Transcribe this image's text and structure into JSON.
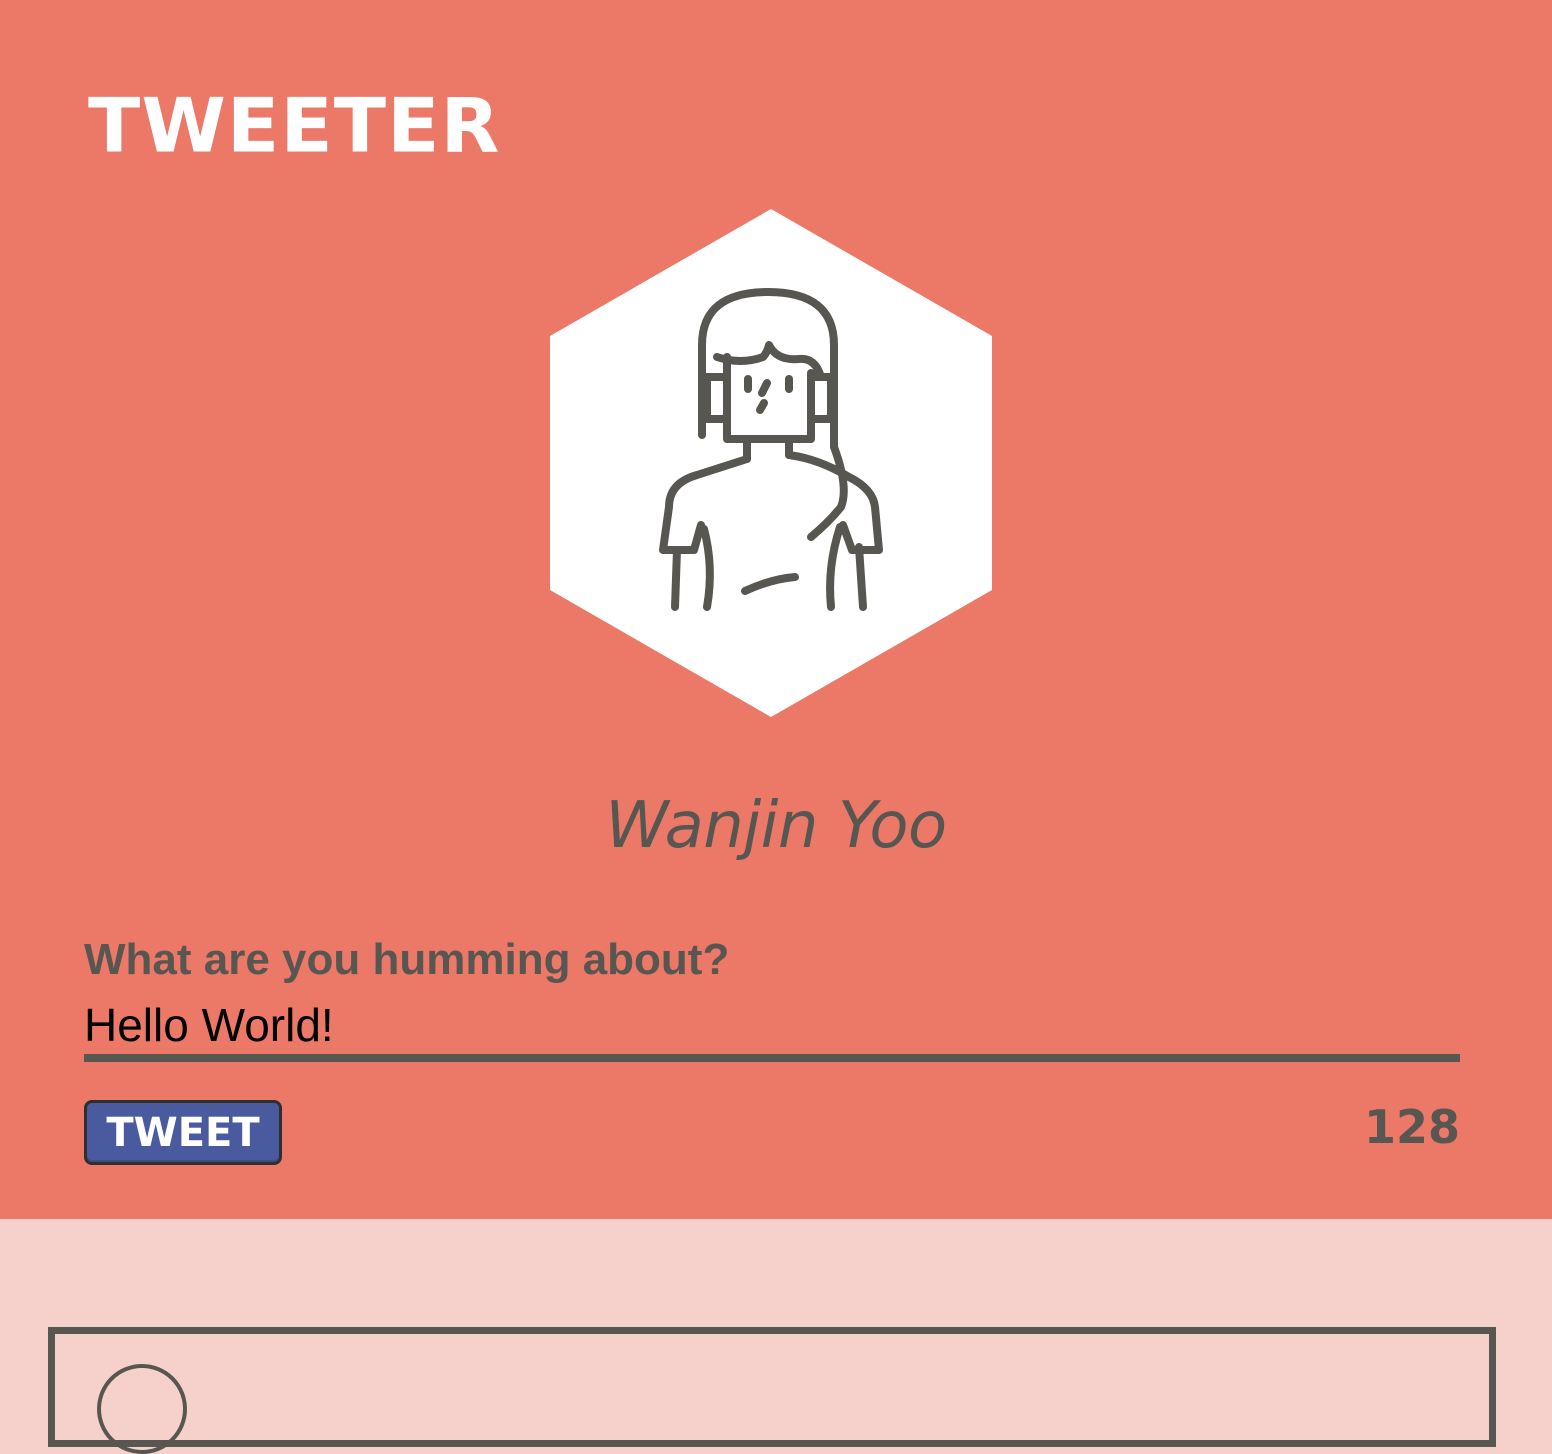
{
  "app": {
    "brand": "TWEETER"
  },
  "profile": {
    "name": "Wanjin Yoo",
    "avatar_icon": "woman-avatar-icon"
  },
  "composer": {
    "prompt": "What are you humming about?",
    "input_value": "Hello World!",
    "button_label": "TWEET",
    "char_count": "128"
  },
  "colors": {
    "header_bg": "#ec7868",
    "page_bg": "#f6d1cb",
    "text_dark": "#585650",
    "button_bg": "#4a5a9e"
  }
}
